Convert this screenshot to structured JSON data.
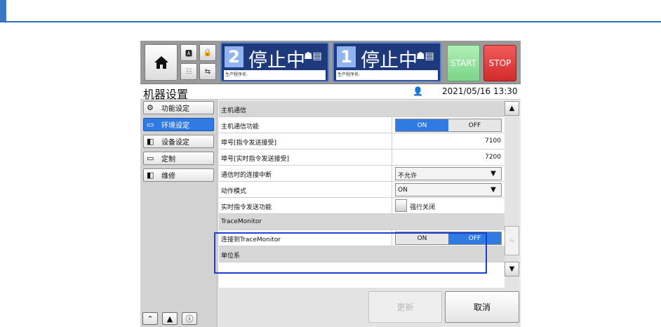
{
  "top": {
    "status1": {
      "number": "2",
      "text": "停止中",
      "sub": "生产程序名:"
    },
    "status2": {
      "number": "1",
      "text": "停止中",
      "sub": "生产程序名:"
    },
    "start_label": "START",
    "stop_label": "STOP"
  },
  "title": "机器设置",
  "datetime": "2021/05/16 13:30",
  "sidebar": {
    "items": [
      {
        "label": "功能设定",
        "icon": "function-settings-icon",
        "active": false
      },
      {
        "label": "环境设定",
        "icon": "environment-settings-icon",
        "active": true
      },
      {
        "label": "设备设定",
        "icon": "equipment-settings-icon",
        "active": false
      },
      {
        "label": "定制",
        "icon": "custom-icon",
        "active": false
      },
      {
        "label": "维修",
        "icon": "maintenance-icon",
        "active": false
      }
    ]
  },
  "settings": {
    "section_host": "主机通信",
    "host_comm_label": "主机通信功能",
    "host_comm_on": "ON",
    "host_comm_off": "OFF",
    "port_cmd_label": "埠号[指令发送接受]",
    "port_cmd_value": "7100",
    "port_rt_label": "埠号[实时指令发送接受]",
    "port_rt_value": "7200",
    "disconnect_label": "通信时的连接中断",
    "disconnect_value": "不允许",
    "mode_label": "动作模式",
    "mode_value": "ON",
    "rt_func_label": "实时指令发送功能",
    "rt_func_check_label": "强行关闭",
    "section_trace": "TraceMonitor",
    "trace_label": "连接到TraceMonitor",
    "trace_on": "ON",
    "trace_off": "OFF",
    "section_unit": "单位系"
  },
  "buttons": {
    "update": "更新",
    "cancel": "取消"
  },
  "colors": {
    "accent_blue": "#2f7be2",
    "highlight_border": "#1c3fd0",
    "start_green": "#7dd48a",
    "stop_red": "#d22b2b"
  }
}
